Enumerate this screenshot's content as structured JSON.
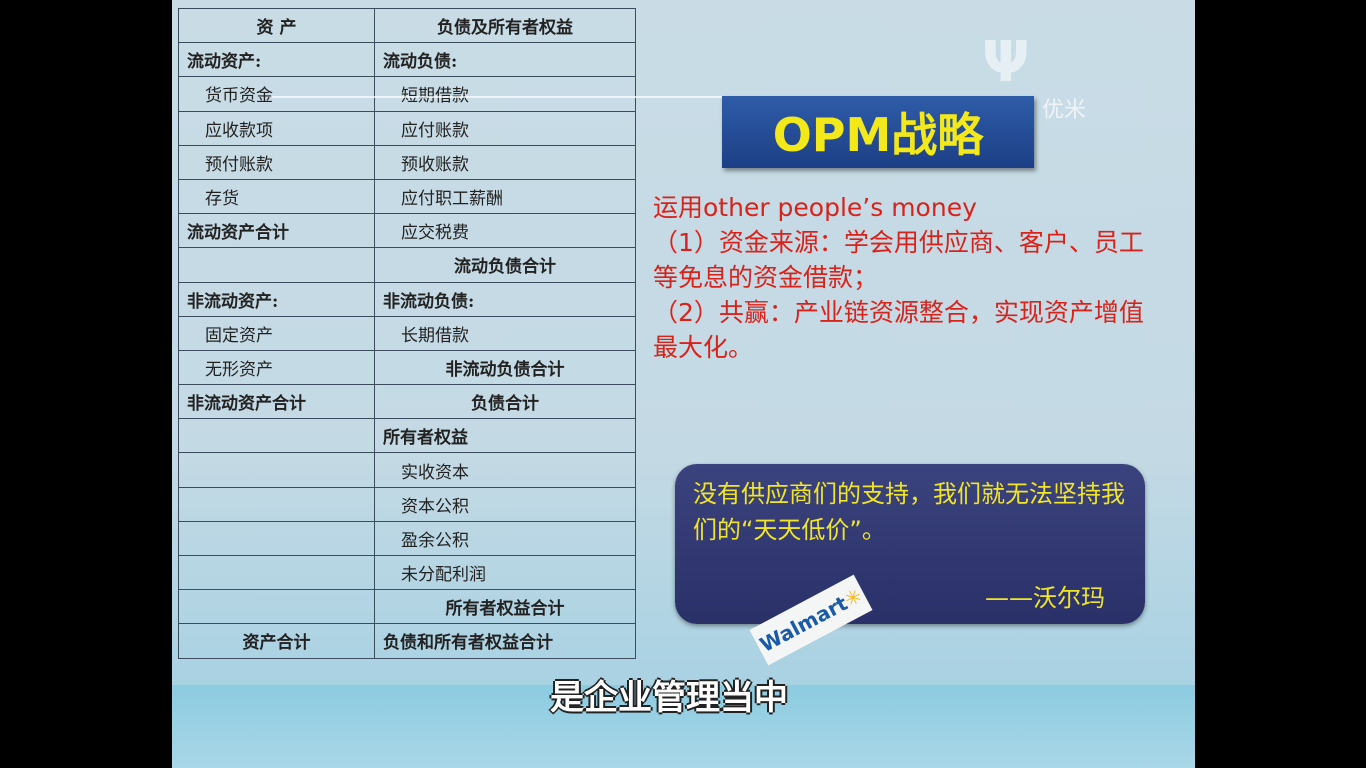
{
  "table": {
    "rows": [
      [
        "资 产",
        "负债及所有者权益"
      ],
      [
        "流动资产:",
        "流动负债:"
      ],
      [
        "货币资金",
        "短期借款"
      ],
      [
        "应收款项",
        "应付账款"
      ],
      [
        "预付账款",
        "预收账款"
      ],
      [
        "存货",
        "应付职工薪酬"
      ],
      [
        "流动资产合计",
        "应交税费"
      ],
      [
        "",
        "流动负债合计"
      ],
      [
        "非流动资产:",
        "非流动负债:"
      ],
      [
        "固定资产",
        "长期借款"
      ],
      [
        "无形资产",
        "非流动负债合计"
      ],
      [
        "非流动资产合计",
        "负债合计"
      ],
      [
        "",
        "所有者权益"
      ],
      [
        "",
        "实收资本"
      ],
      [
        "",
        "资本公积"
      ],
      [
        "",
        "盈余公积"
      ],
      [
        "",
        "未分配利润"
      ],
      [
        "",
        "所有者权益合计"
      ],
      [
        "资产合计",
        "负债和所有者权益合计"
      ]
    ]
  },
  "slide": {
    "title": "OPM战略",
    "lines": [
      "运用other people’s money",
      "（1）资金来源：学会用供应商、客户、员工等免息的资金借款；",
      "（2）共赢：产业链资源整合，实现资产增值最大化。"
    ],
    "quote": "没有供应商们的支持，我们就无法坚持我们的“天天低价”。",
    "quote_attr": "——沃尔玛",
    "walmart_logo": "Walmart"
  },
  "watermark": {
    "icon": "youmi-logo",
    "text": "优米"
  },
  "subtitle": "是企业管理当中",
  "colors": {
    "title_bg": "#2a4f9c",
    "title_text": "#f2e81a",
    "body_text": "#d8231b",
    "quote_bg": "#323a74",
    "quote_text": "#f0e526"
  }
}
